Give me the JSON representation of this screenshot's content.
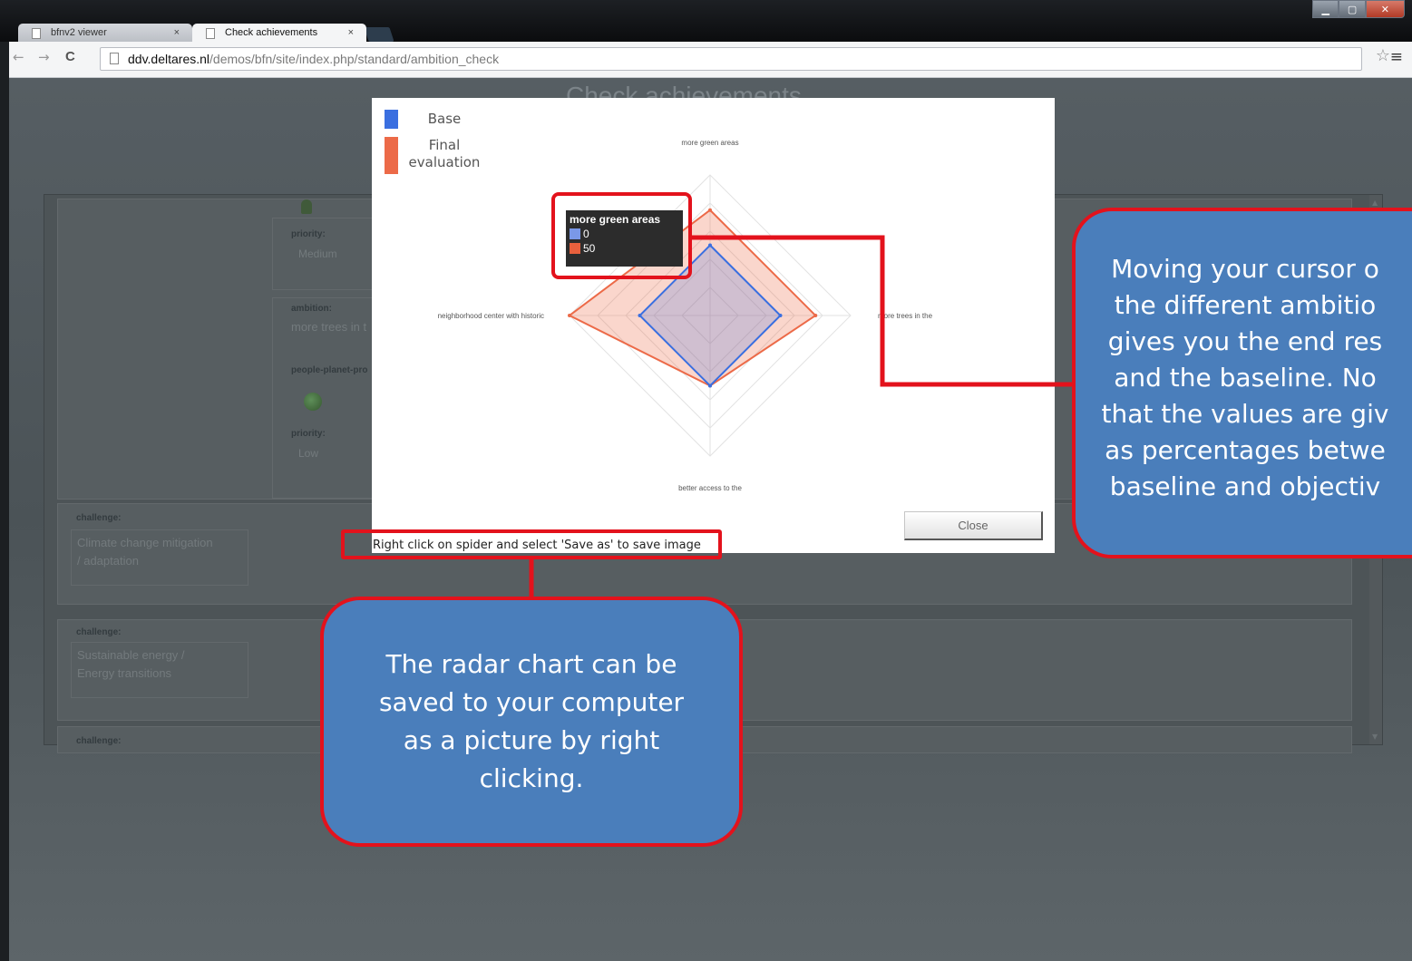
{
  "browser": {
    "tabs": [
      {
        "label": "bfnv2 viewer",
        "close": "×"
      },
      {
        "label": "Check achievements",
        "close": "×"
      }
    ],
    "window_controls": {
      "minimize": "▁",
      "maximize": "▢",
      "close": "✕"
    },
    "nav": {
      "back": "←",
      "forward": "→",
      "reload": "C"
    },
    "url_host": "ddv.deltares.nl",
    "url_path": "/demos/bfn/site/index.php/standard/ambition_check",
    "star": "☆",
    "menu": "≡"
  },
  "page": {
    "title": "Check achievements",
    "details": {
      "priority1_label": "priority:",
      "priority1_value": "Medium",
      "ambition_label": "ambition:",
      "ambition_value": "more trees in t",
      "ppp_label": "people-planet-pro",
      "priority2_label": "priority:",
      "priority2_value": "Low"
    },
    "challenges": [
      {
        "label": "challenge:",
        "line1": "Climate change mitigation",
        "line2": "/ adaptation"
      },
      {
        "label": "challenge:",
        "line1": "Sustainable energy /",
        "line2": "Energy transitions"
      },
      {
        "label": "challenge:",
        "line1": "",
        "line2": ""
      }
    ]
  },
  "dialog": {
    "legend": [
      {
        "label": "Base",
        "color": "#3a6fe0"
      },
      {
        "label": "Final evaluation",
        "color": "#ec6a48"
      }
    ],
    "tooltip": {
      "title": "more green areas",
      "rows": [
        {
          "value": "0",
          "color": "#7a98e8"
        },
        {
          "value": "50",
          "color": "#e8603d"
        }
      ]
    },
    "save_hint": "Right click on spider and select 'Save as' to save image",
    "close_label": "Close"
  },
  "chart_data": {
    "type": "radar",
    "axes": [
      "more green areas",
      "more trees in the",
      "better access to the",
      "neighborhood center with historic"
    ],
    "axis_labels_displayed": [
      "more green areas",
      "more trees in the",
      "better access to the",
      "neighborhood center with historic"
    ],
    "series": [
      {
        "name": "Base",
        "values": [
          0,
          0,
          0,
          0
        ],
        "color": "#3a6fe0"
      },
      {
        "name": "Final evaluation",
        "values": [
          50,
          50,
          0,
          100
        ],
        "color": "#ec6a48"
      }
    ],
    "rlim": [
      -100,
      100
    ],
    "levels": 5,
    "legend_position": "top-left"
  },
  "annotations": {
    "left_callout": [
      "The radar chart can be",
      "saved to your computer",
      "as a picture by right",
      "clicking."
    ],
    "right_callout": [
      "Moving your cursor o",
      "the different ambitio",
      "gives you the end res",
      "and the baseline. No",
      "that the values are giv",
      "as percentages betwe",
      "baseline and objectiv"
    ],
    "highlight_color": "#e3121c",
    "callout_color": "#4a7ebb"
  }
}
